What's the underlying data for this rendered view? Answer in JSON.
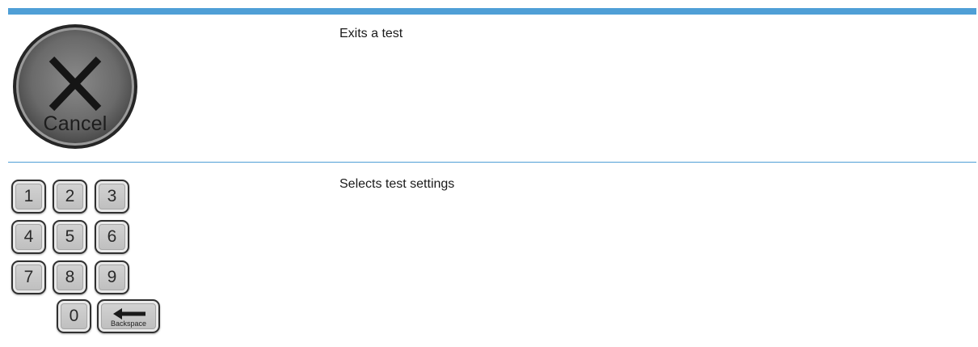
{
  "rows": [
    {
      "control": {
        "label": "Cancel",
        "icon": "close-x-icon"
      },
      "description": "Exits a test"
    },
    {
      "control": {
        "keys": [
          "1",
          "2",
          "3",
          "4",
          "5",
          "6",
          "7",
          "8",
          "9",
          "0"
        ],
        "backspace_label": "Backspace",
        "backspace_icon": "left-arrow-icon"
      },
      "description": "Selects test settings"
    }
  ],
  "colors": {
    "rule": "#4f9fd6",
    "cancel_button": "#6e6e6e",
    "key_face": "#c8c8c8"
  }
}
